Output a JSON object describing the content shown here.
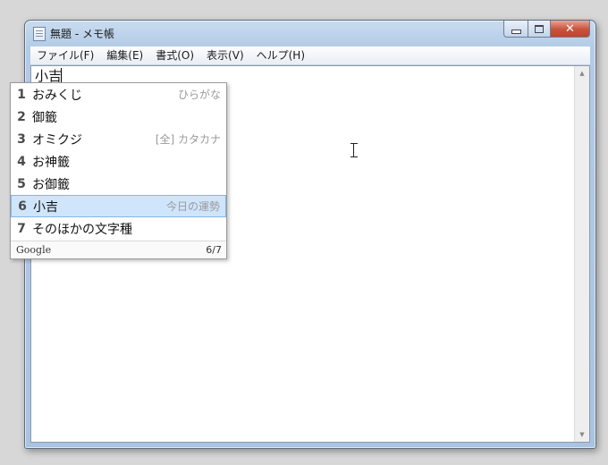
{
  "window": {
    "title": "無題 - メモ帳",
    "controls": {
      "minimize_icon": "minimize-icon",
      "maximize_icon": "maximize-icon",
      "close_label": "✕"
    }
  },
  "menubar": {
    "items": [
      "ファイル(F)",
      "編集(E)",
      "書式(O)",
      "表示(V)",
      "ヘルプ(H)"
    ]
  },
  "editor": {
    "text": "小吉"
  },
  "ime": {
    "candidates": [
      {
        "num": "1",
        "text": "おみくじ",
        "note": "ひらがな"
      },
      {
        "num": "2",
        "text": "御籤",
        "note": ""
      },
      {
        "num": "3",
        "text": "オミクジ",
        "note": "[全] カタカナ"
      },
      {
        "num": "4",
        "text": "お神籤",
        "note": ""
      },
      {
        "num": "5",
        "text": "お御籤",
        "note": ""
      },
      {
        "num": "6",
        "text": "小吉",
        "note": "今日の運勢"
      },
      {
        "num": "7",
        "text": "そのほかの文字種",
        "note": ""
      }
    ],
    "selected_index": 6,
    "brand": "Google",
    "count": "6/7"
  },
  "colors": {
    "selection_bg": "#cfe5fb",
    "close_button": "#c9523b"
  }
}
